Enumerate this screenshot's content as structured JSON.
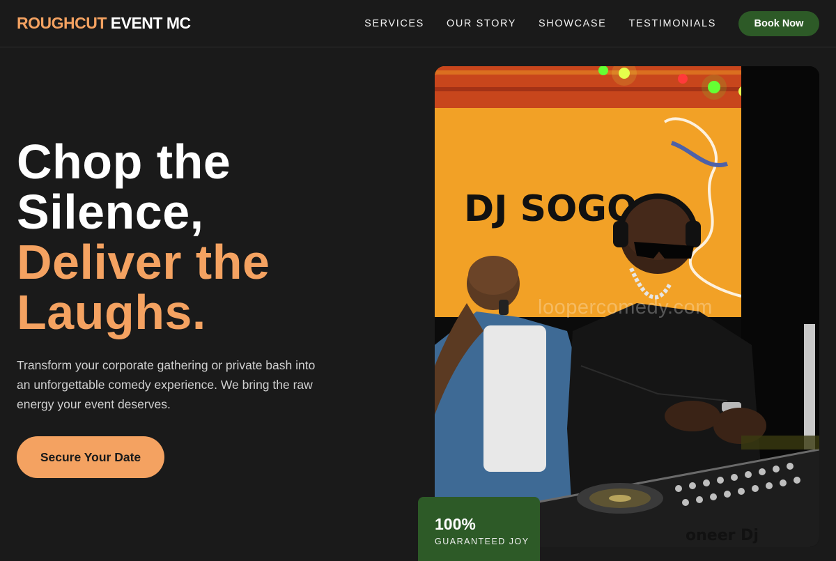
{
  "brand": {
    "accent_text": "ROUGHCUT",
    "rest_text": "EVENT MC"
  },
  "nav": {
    "links": [
      "SERVICES",
      "OUR STORY",
      "SHOWCASE",
      "TESTIMONIALS"
    ],
    "book_label": "Book Now"
  },
  "hero": {
    "headline_white": [
      "Chop the",
      "Silence,"
    ],
    "headline_orange": [
      "Deliver the",
      "Laughs."
    ],
    "subtext": "Transform your corporate gathering or private bash into an unforgettable comedy experience. We bring the raw energy your event deserves.",
    "cta_label": "Secure Your Date"
  },
  "photo": {
    "screen_text": "DJ SOGOO",
    "watermark": "loopercomedy.com",
    "mixer_brand": "oneer Dj"
  },
  "stat": {
    "value": "100%",
    "label": "GUARANTEED JOY"
  },
  "colors": {
    "background": "#1a1a1a",
    "accent_orange": "#f4a261",
    "brand_green": "#2d5a27",
    "text": "#ffffff",
    "muted_text": "#cfcfcf"
  }
}
